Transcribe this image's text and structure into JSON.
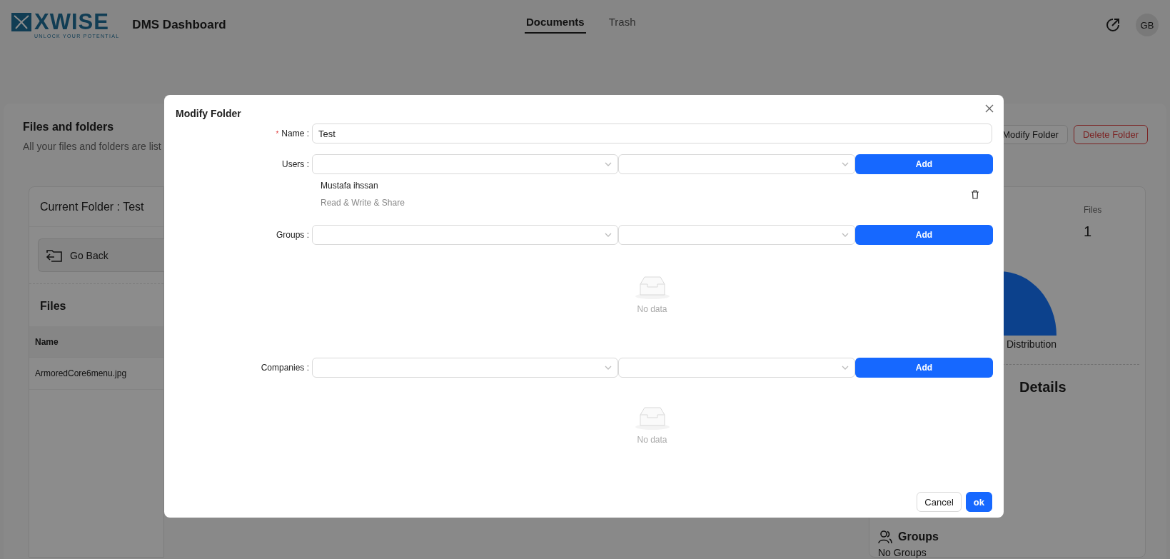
{
  "header": {
    "logo": {
      "wordmark": "XWISE",
      "tagline": "UNLOCK YOUR POTENTIAL"
    },
    "title": "DMS Dashboard",
    "tabs": [
      {
        "label": "Documents",
        "selected": true
      },
      {
        "label": "Trash",
        "selected": false
      }
    ],
    "avatar": "GB"
  },
  "page": {
    "title": "Files and folders",
    "subtitle": "All your files and folders are list",
    "actions": [
      {
        "label": "Modify Folder",
        "kind": "default"
      },
      {
        "label": "Delete Folder",
        "kind": "danger"
      }
    ]
  },
  "folder_panel": {
    "current_folder": "Current Folder : Test",
    "back_button": "Go Back",
    "files_heading": "Files",
    "table": {
      "columns": [
        "Name"
      ],
      "rows": [
        [
          "ArmoredCore6menu.jpg"
        ]
      ]
    }
  },
  "stats_panel": {
    "stat_label": "Files",
    "stat_value": "1",
    "chart_title": "Distribution",
    "details_heading": "Details",
    "groups_heading": "Groups",
    "groups_value": "No Groups"
  },
  "modal": {
    "title": "Modify Folder",
    "fields": [
      {
        "kind": "text",
        "label": "Name :",
        "required_mark": "*",
        "value": "Test"
      },
      {
        "kind": "picker",
        "label": "Users :",
        "add_button": "Add",
        "entries": [
          {
            "name": "Mustafa ihssan",
            "permission": "Read & Write & Share"
          }
        ]
      },
      {
        "kind": "picker",
        "label": "Groups :",
        "add_button": "Add",
        "empty_text": "No data"
      },
      {
        "kind": "picker",
        "label": "Companies :",
        "add_button": "Add",
        "empty_text": "No data"
      }
    ],
    "buttons": [
      {
        "label": "Cancel",
        "kind": "default"
      },
      {
        "label": "ok",
        "kind": "primary"
      }
    ]
  }
}
